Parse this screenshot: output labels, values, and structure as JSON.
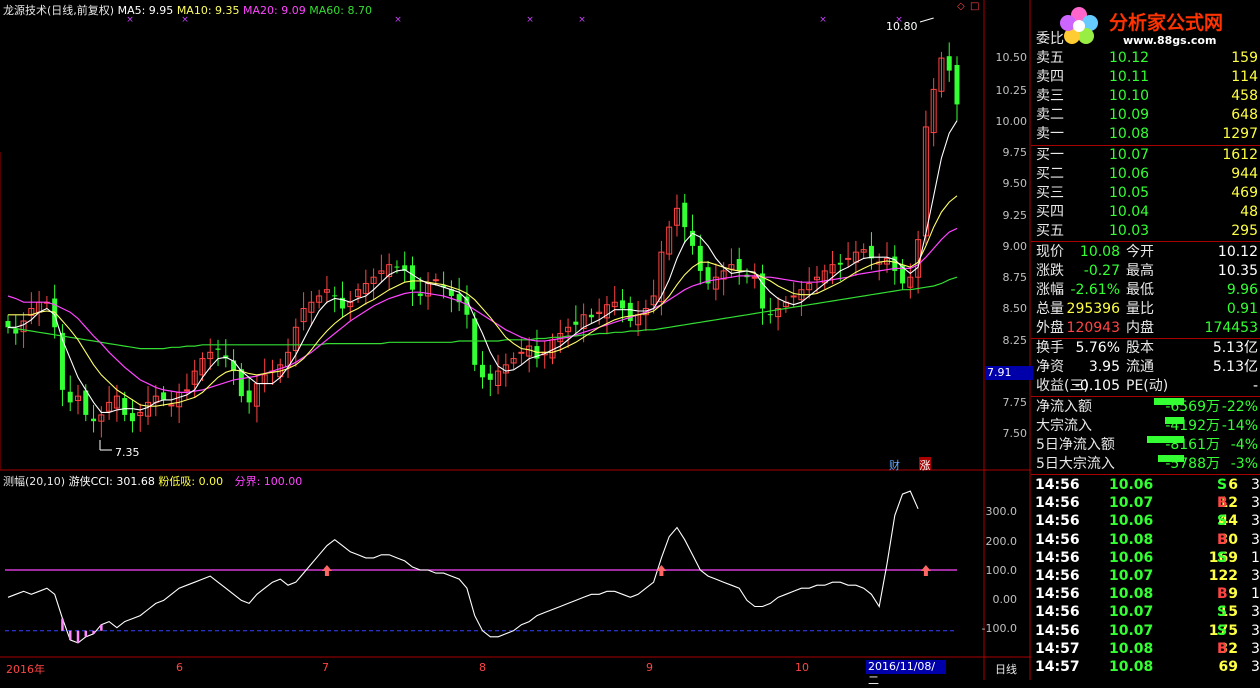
{
  "header": {
    "title": "龙源技术(日线,前复权)",
    "ma5": "MA5: 9.95",
    "ma10": "MA10: 9.35",
    "ma20": "MA20: 9.09",
    "ma60": "MA60: 8.70"
  },
  "indicator_header": {
    "name": "测幅(20,10)",
    "cci": "游侠CCI: 301.68",
    "fendixi": "粉低吸: 0.00",
    "fenjie": "分界: 100.00"
  },
  "price_axis": [
    "10.50",
    "10.25",
    "10.00",
    "9.75",
    "9.50",
    "9.25",
    "9.00",
    "8.75",
    "8.50",
    "8.25",
    "7.75",
    "7.50"
  ],
  "current_price_tag": "7.91",
  "indicator_axis": [
    "300.0",
    "200.0",
    "100.0",
    "0.00",
    "-100.0"
  ],
  "x_axis": {
    "year": "2016年",
    "months": [
      "6",
      "7",
      "8",
      "9",
      "10"
    ],
    "date_cursor": "2016/11/08/二",
    "period": "日线"
  },
  "annotations": {
    "high": "10.80",
    "low": "7.35",
    "badge_cai": "财",
    "badge_zhang": "涨"
  },
  "logo": {
    "title": "分析家公式网",
    "url": "www.88gs.com"
  },
  "order_book": {
    "header": "委比",
    "asks": [
      {
        "label": "卖五",
        "price": "10.12",
        "vol": "159"
      },
      {
        "label": "卖四",
        "price": "10.11",
        "vol": "114"
      },
      {
        "label": "卖三",
        "price": "10.10",
        "vol": "458"
      },
      {
        "label": "卖二",
        "price": "10.09",
        "vol": "648"
      },
      {
        "label": "卖一",
        "price": "10.08",
        "vol": "1297"
      }
    ],
    "bids": [
      {
        "label": "买一",
        "price": "10.07",
        "vol": "1612"
      },
      {
        "label": "买二",
        "price": "10.06",
        "vol": "944"
      },
      {
        "label": "买三",
        "price": "10.05",
        "vol": "469"
      },
      {
        "label": "买四",
        "price": "10.04",
        "vol": "48"
      },
      {
        "label": "买五",
        "price": "10.03",
        "vol": "295"
      }
    ]
  },
  "quote": [
    {
      "l1": "现价",
      "v1": "10.08",
      "l2": "今开",
      "v2": "10.12"
    },
    {
      "l1": "涨跌",
      "v1": "-0.27",
      "l2": "最高",
      "v2": "10.35"
    },
    {
      "l1": "涨幅",
      "v1": "-2.61%",
      "l2": "最低",
      "v2": "9.96"
    },
    {
      "l1": "总量",
      "v1": "295396",
      "l2": "量比",
      "v2": "0.91"
    },
    {
      "l1": "外盘",
      "v1": "120943",
      "l2": "内盘",
      "v2": "174453"
    }
  ],
  "quote2": [
    {
      "l1": "换手",
      "v1": "5.76%",
      "l2": "股本",
      "v2": "5.13亿"
    },
    {
      "l1": "净资",
      "v1": "3.95",
      "l2": "流通",
      "v2": "5.13亿"
    },
    {
      "l1": "收益(三)",
      "v1": "-0.105",
      "l2": "PE(动)",
      "v2": "-"
    }
  ],
  "flows": [
    {
      "label": "净流入额",
      "value": "-6569万",
      "pct": "-22%",
      "bar": 0.55
    },
    {
      "label": "大宗流入",
      "value": "-4192万",
      "pct": "-14%",
      "bar": 0.35
    },
    {
      "label": "5日净流入额",
      "value": "-8161万",
      "pct": "-4%",
      "bar": 0.68
    },
    {
      "label": "5日大宗流入",
      "value": "-5788万",
      "pct": "-3%",
      "bar": 0.48
    }
  ],
  "ticks": [
    {
      "time": "14:56",
      "price": "10.06",
      "vol": "6",
      "side": "S",
      "extra": "3"
    },
    {
      "time": "14:56",
      "price": "10.07",
      "vol": "12",
      "side": "B",
      "extra": "3"
    },
    {
      "time": "14:56",
      "price": "10.06",
      "vol": "44",
      "side": "S",
      "extra": "3"
    },
    {
      "time": "14:56",
      "price": "10.08",
      "vol": "30",
      "side": "B",
      "extra": "3"
    },
    {
      "time": "14:56",
      "price": "10.06",
      "vol": "169",
      "side": "S",
      "extra": "10"
    },
    {
      "time": "14:56",
      "price": "10.07",
      "vol": "122",
      "side": "",
      "extra": "3"
    },
    {
      "time": "14:56",
      "price": "10.08",
      "vol": "9",
      "side": "B",
      "extra": "1"
    },
    {
      "time": "14:56",
      "price": "10.07",
      "vol": "15",
      "side": "S",
      "extra": "3"
    },
    {
      "time": "14:56",
      "price": "10.07",
      "vol": "175",
      "side": "S",
      "extra": "3"
    },
    {
      "time": "14:57",
      "price": "10.08",
      "vol": "32",
      "side": "B",
      "extra": "3"
    },
    {
      "time": "14:57",
      "price": "10.08",
      "vol": "69",
      "side": "",
      "extra": "3"
    }
  ],
  "colors": {
    "up": "#ff4444",
    "down": "#33ff33",
    "ma5": "#ffffff",
    "ma10": "#ffff66",
    "ma20": "#ff44ff",
    "ma60": "#33dd33",
    "frame": "#aa0000",
    "fenjie": "#ff44ff"
  },
  "chart_data": {
    "type": "candlestick",
    "price_range": [
      7.2,
      10.85
    ],
    "indicator_range": [
      -170,
      380
    ],
    "closes": [
      8.3,
      8.25,
      8.35,
      8.45,
      8.5,
      8.5,
      8.3,
      7.8,
      7.7,
      7.75,
      7.6,
      7.55,
      7.6,
      7.7,
      7.75,
      7.6,
      7.55,
      7.62,
      7.7,
      7.75,
      7.72,
      7.68,
      7.78,
      7.8,
      7.95,
      8.05,
      8.1,
      8.12,
      8.05,
      7.95,
      7.75,
      7.7,
      7.85,
      7.92,
      7.95,
      8.0,
      8.1,
      8.3,
      8.45,
      8.5,
      8.55,
      8.6,
      8.55,
      8.45,
      8.5,
      8.6,
      8.65,
      8.7,
      8.75,
      8.8,
      8.78,
      8.75,
      8.6,
      8.55,
      8.65,
      8.68,
      8.62,
      8.55,
      8.5,
      8.4,
      8.0,
      7.9,
      7.88,
      7.95,
      8.0,
      8.05,
      8.1,
      8.15,
      8.05,
      8.1,
      8.2,
      8.25,
      8.3,
      8.32,
      8.4,
      8.38,
      8.42,
      8.48,
      8.5,
      8.45,
      8.35,
      8.4,
      8.45,
      8.55,
      8.9,
      9.1,
      9.25,
      9.1,
      8.95,
      8.75,
      8.65,
      8.7,
      8.75,
      8.8,
      8.75,
      8.7,
      8.7,
      8.45,
      8.4,
      8.45,
      8.5,
      8.55,
      8.6,
      8.65,
      8.7,
      8.75,
      8.8,
      8.8,
      8.85,
      8.9,
      8.92,
      8.85,
      8.82,
      8.85,
      8.75,
      8.65,
      8.7,
      9.0,
      9.9,
      10.2,
      10.45,
      10.35,
      10.08
    ],
    "ma5": [
      8.3,
      8.3,
      8.32,
      8.36,
      8.42,
      8.45,
      8.4,
      8.2,
      8.05,
      7.9,
      7.8,
      7.7,
      7.62,
      7.62,
      7.64,
      7.65,
      7.65,
      7.64,
      7.66,
      7.7,
      7.72,
      7.72,
      7.74,
      7.76,
      7.8,
      7.9,
      7.98,
      8.05,
      8.06,
      8.03,
      7.95,
      7.9,
      7.85,
      7.85,
      7.85,
      7.9,
      7.98,
      8.08,
      8.2,
      8.32,
      8.43,
      8.5,
      8.53,
      8.52,
      8.5,
      8.53,
      8.55,
      8.6,
      8.66,
      8.72,
      8.75,
      8.76,
      8.72,
      8.68,
      8.65,
      8.64,
      8.62,
      8.6,
      8.58,
      8.52,
      8.38,
      8.25,
      8.1,
      7.99,
      7.95,
      7.96,
      8.0,
      8.05,
      8.07,
      8.09,
      8.12,
      8.15,
      8.2,
      8.25,
      8.3,
      8.33,
      8.36,
      8.4,
      8.44,
      8.44,
      8.44,
      8.43,
      8.43,
      8.45,
      8.55,
      8.68,
      8.85,
      8.98,
      9.05,
      9.02,
      8.95,
      8.85,
      8.78,
      8.73,
      8.74,
      8.75,
      8.74,
      8.65,
      8.58,
      8.53,
      8.5,
      8.48,
      8.5,
      8.55,
      8.6,
      8.65,
      8.7,
      8.75,
      8.78,
      8.82,
      8.85,
      8.86,
      8.86,
      8.86,
      8.84,
      8.78,
      8.73,
      8.78,
      9.05,
      9.35,
      9.65,
      9.85,
      9.95
    ],
    "ma10": [
      8.4,
      8.4,
      8.4,
      8.4,
      8.42,
      8.43,
      8.42,
      8.35,
      8.28,
      8.2,
      8.1,
      8.0,
      7.92,
      7.86,
      7.8,
      7.76,
      7.72,
      7.68,
      7.67,
      7.67,
      7.68,
      7.69,
      7.7,
      7.72,
      7.74,
      7.78,
      7.84,
      7.9,
      7.94,
      7.96,
      7.95,
      7.93,
      7.92,
      7.93,
      7.94,
      7.95,
      7.97,
      8.0,
      8.05,
      8.12,
      8.2,
      8.27,
      8.33,
      8.38,
      8.42,
      8.45,
      8.49,
      8.52,
      8.56,
      8.6,
      8.63,
      8.66,
      8.67,
      8.67,
      8.66,
      8.65,
      8.64,
      8.62,
      8.6,
      8.57,
      8.52,
      8.45,
      8.38,
      8.3,
      8.22,
      8.17,
      8.13,
      8.12,
      8.1,
      8.1,
      8.1,
      8.12,
      8.15,
      8.18,
      8.22,
      8.26,
      8.3,
      8.33,
      8.36,
      8.38,
      8.39,
      8.4,
      8.41,
      8.43,
      8.48,
      8.55,
      8.64,
      8.72,
      8.78,
      8.82,
      8.82,
      8.8,
      8.78,
      8.76,
      8.75,
      8.75,
      8.73,
      8.7,
      8.67,
      8.63,
      8.6,
      8.57,
      8.56,
      8.56,
      8.57,
      8.6,
      8.63,
      8.66,
      8.7,
      8.74,
      8.77,
      8.8,
      8.82,
      8.83,
      8.82,
      8.8,
      8.78,
      8.82,
      8.95,
      9.1,
      9.22,
      9.3,
      9.35
    ],
    "ma20": [
      8.55,
      8.53,
      8.5,
      8.5,
      8.5,
      8.5,
      8.48,
      8.45,
      8.42,
      8.37,
      8.3,
      8.23,
      8.17,
      8.1,
      8.04,
      7.98,
      7.93,
      7.88,
      7.85,
      7.82,
      7.8,
      7.79,
      7.78,
      7.78,
      7.79,
      7.8,
      7.82,
      7.84,
      7.86,
      7.88,
      7.89,
      7.9,
      7.91,
      7.93,
      7.95,
      7.97,
      7.99,
      8.02,
      8.06,
      8.1,
      8.15,
      8.2,
      8.25,
      8.3,
      8.35,
      8.39,
      8.43,
      8.47,
      8.5,
      8.53,
      8.55,
      8.57,
      8.58,
      8.58,
      8.57,
      8.56,
      8.55,
      8.53,
      8.51,
      8.48,
      8.44,
      8.4,
      8.36,
      8.32,
      8.28,
      8.25,
      8.22,
      8.2,
      8.19,
      8.19,
      8.2,
      8.21,
      8.22,
      8.24,
      8.26,
      8.28,
      8.3,
      8.32,
      8.34,
      8.36,
      8.38,
      8.4,
      8.42,
      8.45,
      8.48,
      8.52,
      8.56,
      8.6,
      8.63,
      8.65,
      8.67,
      8.68,
      8.69,
      8.7,
      8.71,
      8.71,
      8.71,
      8.7,
      8.7,
      8.69,
      8.68,
      8.67,
      8.66,
      8.66,
      8.66,
      8.67,
      8.68,
      8.69,
      8.7,
      8.72,
      8.73,
      8.74,
      8.75,
      8.76,
      8.77,
      8.77,
      8.77,
      8.8,
      8.86,
      8.93,
      9.0,
      9.06,
      9.09
    ],
    "ma60": [
      8.3,
      8.29,
      8.28,
      8.27,
      8.26,
      8.25,
      8.24,
      8.23,
      8.22,
      8.21,
      8.2,
      8.19,
      8.18,
      8.17,
      8.16,
      8.15,
      8.14,
      8.13,
      8.13,
      8.13,
      8.13,
      8.14,
      8.14,
      8.15,
      8.15,
      8.16,
      8.16,
      8.16,
      8.16,
      8.16,
      8.16,
      8.16,
      8.16,
      8.16,
      8.16,
      8.16,
      8.16,
      8.16,
      8.16,
      8.16,
      8.16,
      8.17,
      8.17,
      8.17,
      8.17,
      8.17,
      8.17,
      8.17,
      8.17,
      8.18,
      8.18,
      8.18,
      8.18,
      8.18,
      8.18,
      8.18,
      8.18,
      8.18,
      8.19,
      8.19,
      8.19,
      8.19,
      8.19,
      8.19,
      8.2,
      8.2,
      8.2,
      8.2,
      8.21,
      8.21,
      8.22,
      8.22,
      8.23,
      8.23,
      8.24,
      8.24,
      8.25,
      8.25,
      8.26,
      8.26,
      8.27,
      8.27,
      8.28,
      8.28,
      8.29,
      8.3,
      8.31,
      8.32,
      8.33,
      8.34,
      8.35,
      8.36,
      8.37,
      8.38,
      8.39,
      8.4,
      8.41,
      8.42,
      8.43,
      8.44,
      8.45,
      8.46,
      8.47,
      8.48,
      8.49,
      8.5,
      8.51,
      8.52,
      8.53,
      8.54,
      8.55,
      8.56,
      8.57,
      8.58,
      8.59,
      8.6,
      8.6,
      8.61,
      8.62,
      8.63,
      8.65,
      8.68,
      8.7
    ],
    "cci": [
      10,
      20,
      30,
      20,
      30,
      40,
      20,
      -60,
      -130,
      -140,
      -120,
      -110,
      -80,
      -70,
      -90,
      -70,
      -60,
      -50,
      -30,
      -10,
      0,
      20,
      40,
      50,
      60,
      70,
      80,
      60,
      40,
      20,
      0,
      -10,
      20,
      40,
      60,
      70,
      50,
      60,
      90,
      120,
      150,
      180,
      200,
      180,
      160,
      150,
      140,
      140,
      150,
      150,
      140,
      130,
      110,
      100,
      100,
      90,
      90,
      80,
      70,
      40,
      -50,
      -100,
      -120,
      -120,
      -110,
      -100,
      -80,
      -70,
      -50,
      -40,
      -30,
      -20,
      -10,
      0,
      10,
      20,
      20,
      30,
      30,
      20,
      10,
      20,
      40,
      60,
      140,
      210,
      240,
      200,
      150,
      100,
      80,
      70,
      60,
      50,
      40,
      0,
      -20,
      -20,
      -10,
      10,
      20,
      30,
      40,
      40,
      50,
      50,
      60,
      60,
      50,
      50,
      40,
      20,
      -20,
      120,
      280,
      350,
      360,
      301.68
    ],
    "fenjie": 100,
    "high_label": 10.8,
    "low_label": 7.35
  }
}
